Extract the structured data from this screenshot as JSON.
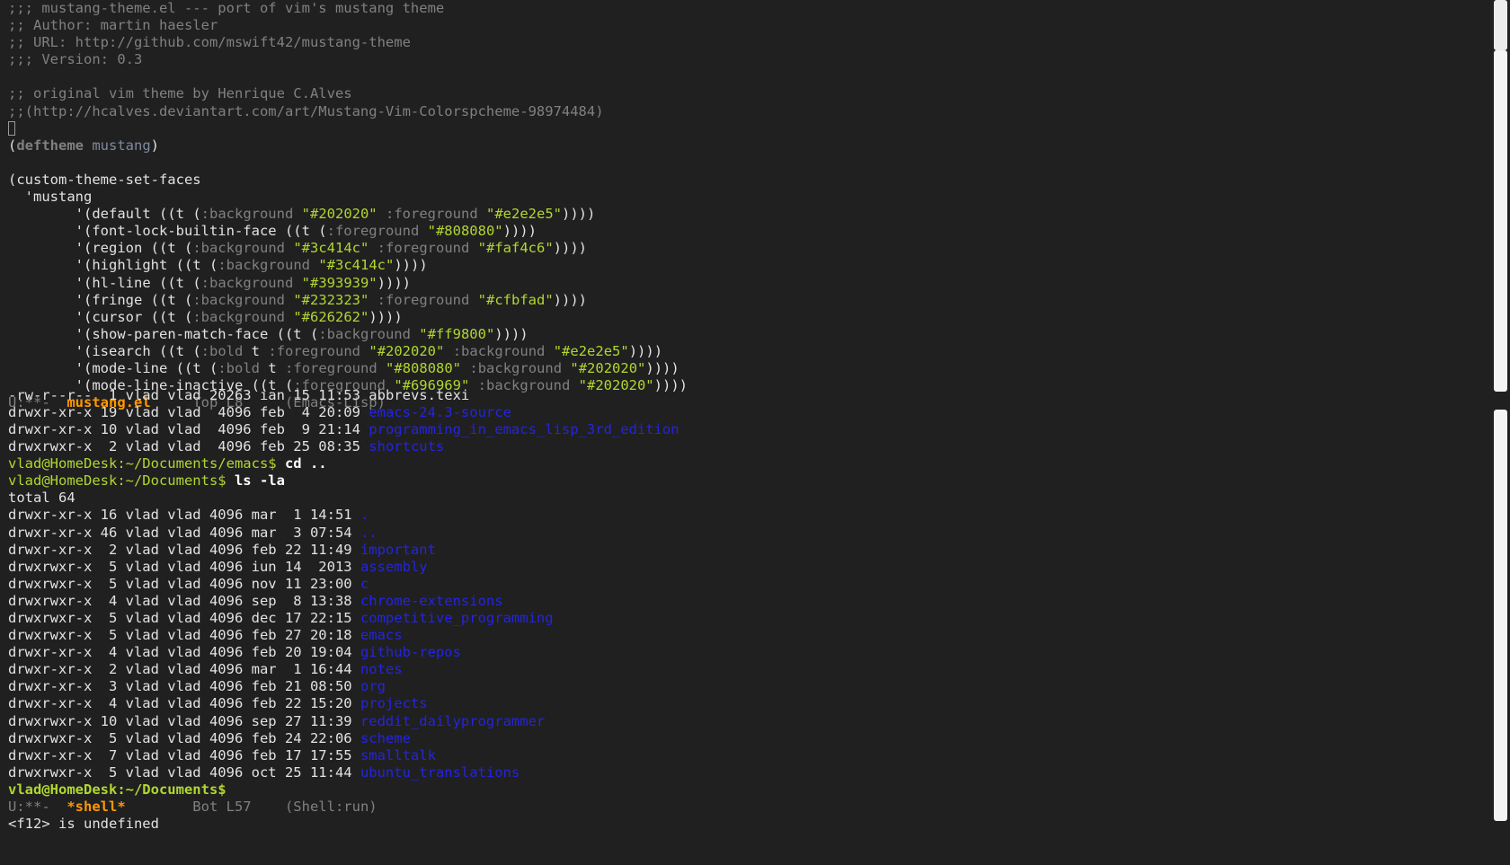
{
  "editor": {
    "comment_lines": [
      ";;; mustang-theme.el --- port of vim's mustang theme",
      ";; Author: martin haesler",
      ";; URL: http://github.com/mswift42/mustang-theme",
      ";;; Version: 0.3",
      "",
      ";; original vim theme by Henrique C.Alves",
      ";;(http://hcalves.deviantart.com/art/Mustang-Vim-Colorspcheme-98974484)"
    ],
    "deftheme": {
      "open": "(",
      "keyword": "deftheme",
      "name": "mustang",
      "close": ")"
    },
    "set_faces_line": "(custom-theme-set-faces",
    "quote_line": "  'mustang",
    "faces": [
      {
        "name": "default",
        "attrs": [
          [
            ":background",
            "\"#202020\""
          ],
          [
            ":foreground",
            "\"#e2e2e5\""
          ]
        ]
      },
      {
        "name": "font-lock-builtin-face",
        "attrs": [
          [
            ":foreground",
            "\"#808080\""
          ]
        ]
      },
      {
        "name": "region",
        "attrs": [
          [
            ":background",
            "\"#3c414c\""
          ],
          [
            ":foreground",
            "\"#faf4c6\""
          ]
        ]
      },
      {
        "name": "highlight",
        "attrs": [
          [
            ":background",
            "\"#3c414c\""
          ]
        ]
      },
      {
        "name": "hl-line",
        "attrs": [
          [
            ":background",
            "\"#393939\""
          ]
        ]
      },
      {
        "name": "fringe",
        "attrs": [
          [
            ":background",
            "\"#232323\""
          ],
          [
            ":foreground",
            "\"#cfbfad\""
          ]
        ]
      },
      {
        "name": "cursor",
        "attrs": [
          [
            ":background",
            "\"#626262\""
          ]
        ]
      },
      {
        "name": "show-paren-match-face",
        "attrs": [
          [
            ":background",
            "\"#ff9800\""
          ]
        ]
      },
      {
        "name": "isearch",
        "attrs": [
          [
            ":bold",
            "t"
          ],
          [
            ":foreground",
            "\"#202020\""
          ],
          [
            ":background",
            "\"#e2e2e5\""
          ]
        ]
      },
      {
        "name": "mode-line",
        "attrs": [
          [
            ":bold",
            "t"
          ],
          [
            ":foreground",
            "\"#808080\""
          ],
          [
            ":background",
            "\"#202020\""
          ]
        ]
      },
      {
        "name": "mode-line-inactive",
        "attrs": [
          [
            ":foreground",
            "\"#696969\""
          ],
          [
            ":background",
            "\"#202020\""
          ]
        ]
      }
    ],
    "modeline": {
      "state": "U:**-  ",
      "buffer": "mustang.el",
      "position": "     Top L8",
      "mode": "     (Emacs-Lisp)"
    }
  },
  "shell": {
    "prev_listing": [
      {
        "meta": "-rw-r--r--  1 vlad vlad 20263 ian 15 11:53 ",
        "name": "abbrevs.texi",
        "is_dir": false
      },
      {
        "meta": "drwxr-xr-x 19 vlad vlad  4096 feb  4 20:09 ",
        "name": "emacs-24.3-source",
        "is_dir": true
      },
      {
        "meta": "drwxr-xr-x 10 vlad vlad  4096 feb  9 21:14 ",
        "name": "programming_in_emacs_lisp_3rd_edition",
        "is_dir": true
      },
      {
        "meta": "drwxrwxr-x  2 vlad vlad  4096 feb 25 08:35 ",
        "name": "shortcuts",
        "is_dir": true
      }
    ],
    "cmd1": {
      "prompt": "vlad@HomeDesk:~/Documents/emacs$ ",
      "command": "cd .."
    },
    "cmd2": {
      "prompt": "vlad@HomeDesk:~/Documents$ ",
      "command": "ls -la"
    },
    "total": "total 64",
    "listing": [
      {
        "meta": "drwxr-xr-x 16 vlad vlad 4096 mar  1 14:51 ",
        "name": "."
      },
      {
        "meta": "drwxr-xr-x 46 vlad vlad 4096 mar  3 07:54 ",
        "name": ".."
      },
      {
        "meta": "drwxr-xr-x  2 vlad vlad 4096 feb 22 11:49 ",
        "name": "important"
      },
      {
        "meta": "drwxrwxr-x  5 vlad vlad 4096 iun 14  2013 ",
        "name": "assembly"
      },
      {
        "meta": "drwxrwxr-x  5 vlad vlad 4096 nov 11 23:00 ",
        "name": "c"
      },
      {
        "meta": "drwxrwxr-x  4 vlad vlad 4096 sep  8 13:38 ",
        "name": "chrome-extensions"
      },
      {
        "meta": "drwxrwxr-x  5 vlad vlad 4096 dec 17 22:15 ",
        "name": "competitive_programming"
      },
      {
        "meta": "drwxrwxr-x  5 vlad vlad 4096 feb 27 20:18 ",
        "name": "emacs"
      },
      {
        "meta": "drwxr-xr-x  4 vlad vlad 4096 feb 20 19:04 ",
        "name": "github-repos"
      },
      {
        "meta": "drwxr-xr-x  2 vlad vlad 4096 mar  1 16:44 ",
        "name": "notes"
      },
      {
        "meta": "drwxr-xr-x  3 vlad vlad 4096 feb 21 08:50 ",
        "name": "org"
      },
      {
        "meta": "drwxr-xr-x  4 vlad vlad 4096 feb 22 15:20 ",
        "name": "projects"
      },
      {
        "meta": "drwxrwxr-x 10 vlad vlad 4096 sep 27 11:39 ",
        "name": "reddit_dailyprogrammer"
      },
      {
        "meta": "drwxrwxr-x  5 vlad vlad 4096 feb 24 22:06 ",
        "name": "scheme"
      },
      {
        "meta": "drwxr-xr-x  7 vlad vlad 4096 feb 17 17:55 ",
        "name": "smalltalk"
      },
      {
        "meta": "drwxrwxr-x  5 vlad vlad 4096 oct 25 11:44 ",
        "name": "ubuntu_translations"
      }
    ],
    "final_prompt": "vlad@HomeDesk:~/Documents$",
    "modeline": {
      "state": "U:**-  ",
      "buffer": "*shell*",
      "position": "        Bot L57",
      "mode": "    (Shell:run)"
    }
  },
  "minibuffer": {
    "message": "<f12> is undefined"
  },
  "colors": {
    "background": "#202020",
    "foreground": "#e2e2e5",
    "comment": "#808080",
    "string": "#b1d631",
    "directory": "#2424e0",
    "modeline_buffer": "#ff9800"
  }
}
